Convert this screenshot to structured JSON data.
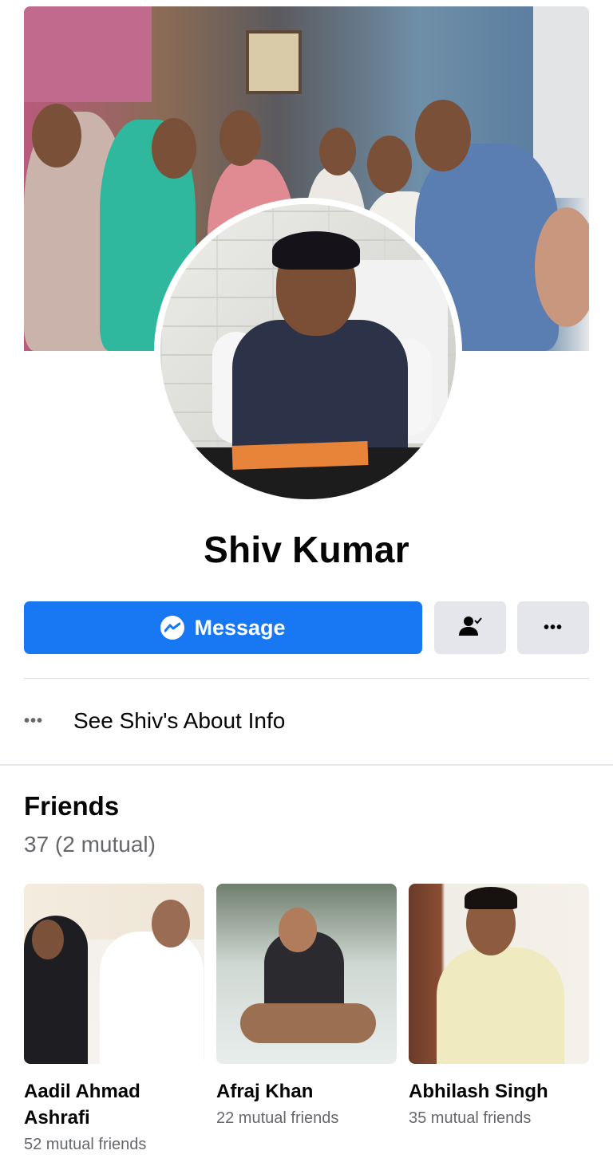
{
  "profile": {
    "name": "Shiv Kumar",
    "cover_alt": "cover-photo",
    "avatar_alt": "profile-picture"
  },
  "actions": {
    "message_label": "Message",
    "friend_icon": "friend-status-icon",
    "more_icon": "more-dots-icon",
    "more_label": "•••"
  },
  "about": {
    "dots": "•••",
    "label": "See Shiv's About Info"
  },
  "friends": {
    "title": "Friends",
    "count": "37 (2 mutual)",
    "items": [
      {
        "name": "Aadil Ahmad Ashrafi",
        "mutual": "52 mutual friends"
      },
      {
        "name": "Afraj Khan",
        "mutual": "22 mutual friends"
      },
      {
        "name": "Abhilash Singh",
        "mutual": "35 mutual friends"
      }
    ]
  },
  "colors": {
    "accent": "#1877f2",
    "button_gray": "#e4e6eb",
    "secondary_text": "#65676b"
  }
}
